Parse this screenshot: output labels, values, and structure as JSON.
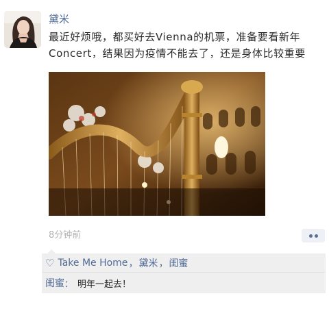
{
  "post": {
    "author": "黛米",
    "content": "最近好烦哦，都买好去Vienna的机票，准备要看新年\nConcert，结果因为疫情不能去了，还是身体比较重要",
    "time": "8分钟前"
  },
  "likes": {
    "icon": "heart-outline-icon",
    "names": [
      "Take Me Home",
      "黛米",
      "闺蜜"
    ],
    "separator": "，"
  },
  "comments": [
    {
      "author": "闺蜜",
      "colon": "：",
      "text": "明年一起去！"
    }
  ],
  "colors": {
    "link_blue": "#4f6a95",
    "feedback_bg": "#efefef",
    "time_gray": "#b2b2b2"
  }
}
